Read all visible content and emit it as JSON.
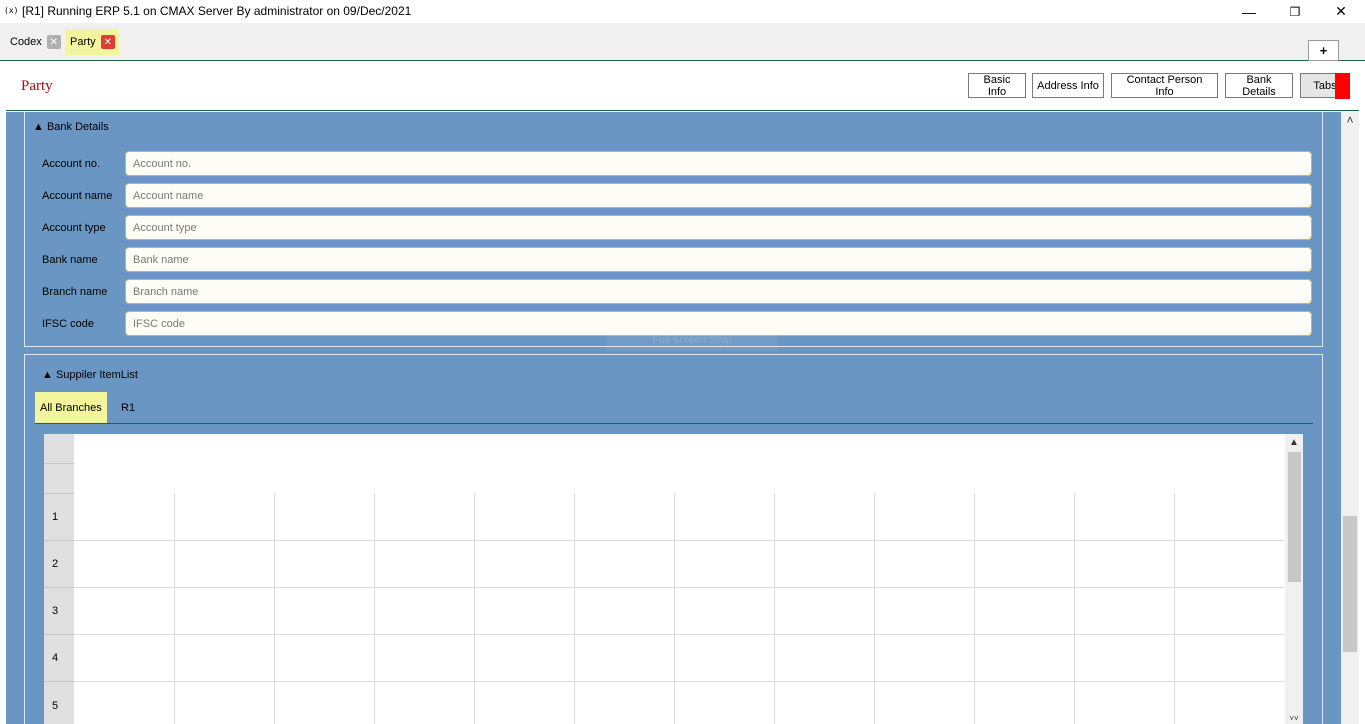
{
  "window": {
    "app_icon": "(x)",
    "title": "[R1] Running ERP 5.1 on CMAX Server By administrator on 09/Dec/2021",
    "minimize": "—",
    "maximize": "❐",
    "close": "✕"
  },
  "doc_tabs": [
    {
      "label": "Codex",
      "close": "✕"
    },
    {
      "label": "Party",
      "close": "✕"
    }
  ],
  "add_tab_label": "+",
  "header": {
    "title": "Party",
    "buttons": [
      "Basic Info",
      "Address Info",
      "Contact Person Info",
      "Bank Details",
      "Tabs"
    ]
  },
  "bank_details": {
    "title": "▲ Bank Details",
    "fields": [
      {
        "label": "Account no.",
        "placeholder": "Account no.",
        "value": ""
      },
      {
        "label": "Account name",
        "placeholder": "Account name",
        "value": ""
      },
      {
        "label": "Account type",
        "placeholder": "Account type",
        "value": ""
      },
      {
        "label": "Bank name",
        "placeholder": "Bank name",
        "value": ""
      },
      {
        "label": "Branch name",
        "placeholder": "Branch name",
        "value": ""
      },
      {
        "label": "IFSC code",
        "placeholder": "IFSC code",
        "value": ""
      }
    ]
  },
  "overlay_hint": "Full-screen Snip",
  "supplier_list": {
    "title": "▲ Suppiler ItemList",
    "branch_tabs": [
      "All Branches",
      "R1"
    ],
    "row_numbers": [
      "1",
      "2",
      "3",
      "4",
      "5"
    ]
  },
  "scroll": {
    "up_arrow": "▲",
    "down_arrow": "˅˅",
    "page_up_arrow": "˄"
  },
  "colors": {
    "content_bg": "#6996c2",
    "active_tab": "#f2f59c",
    "title_red": "#a01010",
    "divider_green": "#1e6b35"
  }
}
